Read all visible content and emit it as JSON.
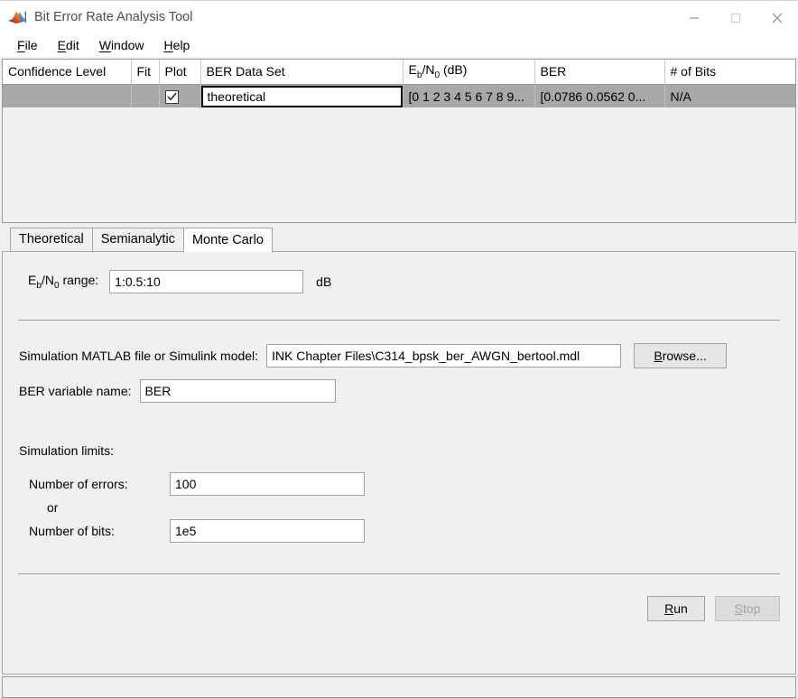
{
  "window": {
    "title": "Bit Error Rate Analysis Tool",
    "logo_icon": "matlab-membrane-icon",
    "minimize_icon": "minimize-icon",
    "maximize_icon": "maximize-icon",
    "close_icon": "close-icon"
  },
  "menu": {
    "items": [
      {
        "label": "File",
        "mnemonic": "F",
        "rest": "ile"
      },
      {
        "label": "Edit",
        "mnemonic": "E",
        "rest": "dit"
      },
      {
        "label": "Window",
        "mnemonic": "W",
        "rest": "indow"
      },
      {
        "label": "Help",
        "mnemonic": "H",
        "rest": "elp"
      }
    ]
  },
  "table": {
    "columns": [
      "Confidence Level",
      "Fit",
      "Plot",
      "BER Data Set",
      "Eb/N0 (dB)",
      "BER",
      "# of Bits"
    ],
    "rows": [
      {
        "confidence_level": "",
        "fit": "",
        "plot_checked": true,
        "ber_data_set": "theoretical",
        "ebno_db": "[0 1 2 3 4 5 6 7 8 9...",
        "ber": "[0.0786  0.0562  0...",
        "num_bits": "N/A"
      }
    ]
  },
  "tabs": {
    "items": [
      {
        "label": "Theoretical",
        "active": false
      },
      {
        "label": "Semianalytic",
        "active": false
      },
      {
        "label": "Monte Carlo",
        "active": true
      }
    ]
  },
  "monte_carlo": {
    "ebno_range_label": "range:",
    "ebno_range_value": "1:0.5:10",
    "ebno_range_units": "dB",
    "sim_file_label": "Simulation MATLAB file or Simulink model:",
    "sim_file_value": "INK Chapter Files\\C314_bpsk_ber_AWGN_bertool.mdl",
    "browse_label": "Browse...",
    "browse_mnemonic": "B",
    "browse_rest": "rowse...",
    "ber_variable_label": "BER variable name:",
    "ber_variable_value": "BER",
    "simulation_limits_label": "Simulation limits:",
    "num_errors_label": "Number of errors:",
    "num_errors_value": "100",
    "or_label": "or",
    "num_bits_label": "Number of bits:",
    "num_bits_value": "1e5",
    "run_label": "Run",
    "run_mnemonic": "R",
    "run_rest": "un",
    "stop_label": "Stop",
    "stop_mnemonic": "S",
    "stop_rest": "top",
    "stop_disabled": true
  },
  "colors": {
    "window_bg": "#f0f0f0",
    "titlebar_bg": "#ffffff",
    "selected_row_bg": "#a8a8a8",
    "border": "#9a9a9a",
    "disabled_text": "#a3a3a3"
  }
}
